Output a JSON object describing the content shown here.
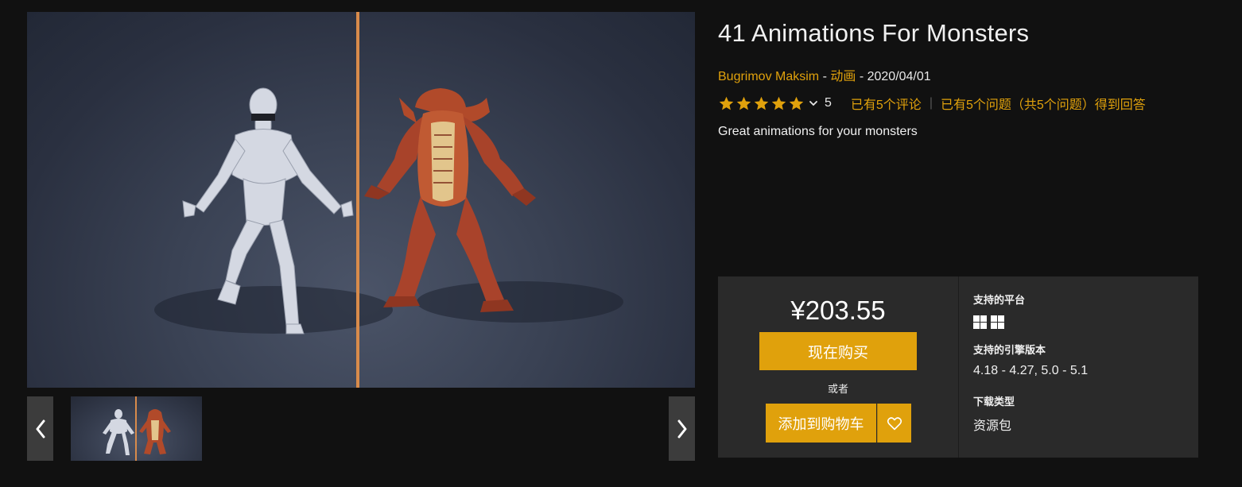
{
  "product": {
    "title": "41 Animations For Monsters",
    "author": "Bugrimov Maksim",
    "category": "动画",
    "date": "2020/04/01",
    "separator": " - ",
    "tagline": "Great animations for your monsters"
  },
  "rating": {
    "stars": 5,
    "count_label": "5",
    "reviews_link": "已有5个评论",
    "divider": "|",
    "questions_link": "已有5个问题（共5个问题）得到回答",
    "star_color": "#e0a10c"
  },
  "gallery": {
    "selected_index": 0,
    "thumbnail_count": 1,
    "prev_icon": "chevron-left-icon",
    "next_icon": "chevron-right-icon"
  },
  "purchase": {
    "price": "¥203.55",
    "buy_label": "现在购买",
    "or_label": "或者",
    "cart_label": "添加到购物车",
    "wishlist_icon": "heart-icon",
    "accent_color": "#e0a10c"
  },
  "specs": {
    "platforms_label": "支持的平台",
    "platforms": [
      "windows-icon",
      "windows-icon"
    ],
    "engine_label": "支持的引擎版本",
    "engine_versions": "4.18 - 4.27, 5.0 - 5.1",
    "download_label": "下载类型",
    "download_type": "资源包"
  }
}
